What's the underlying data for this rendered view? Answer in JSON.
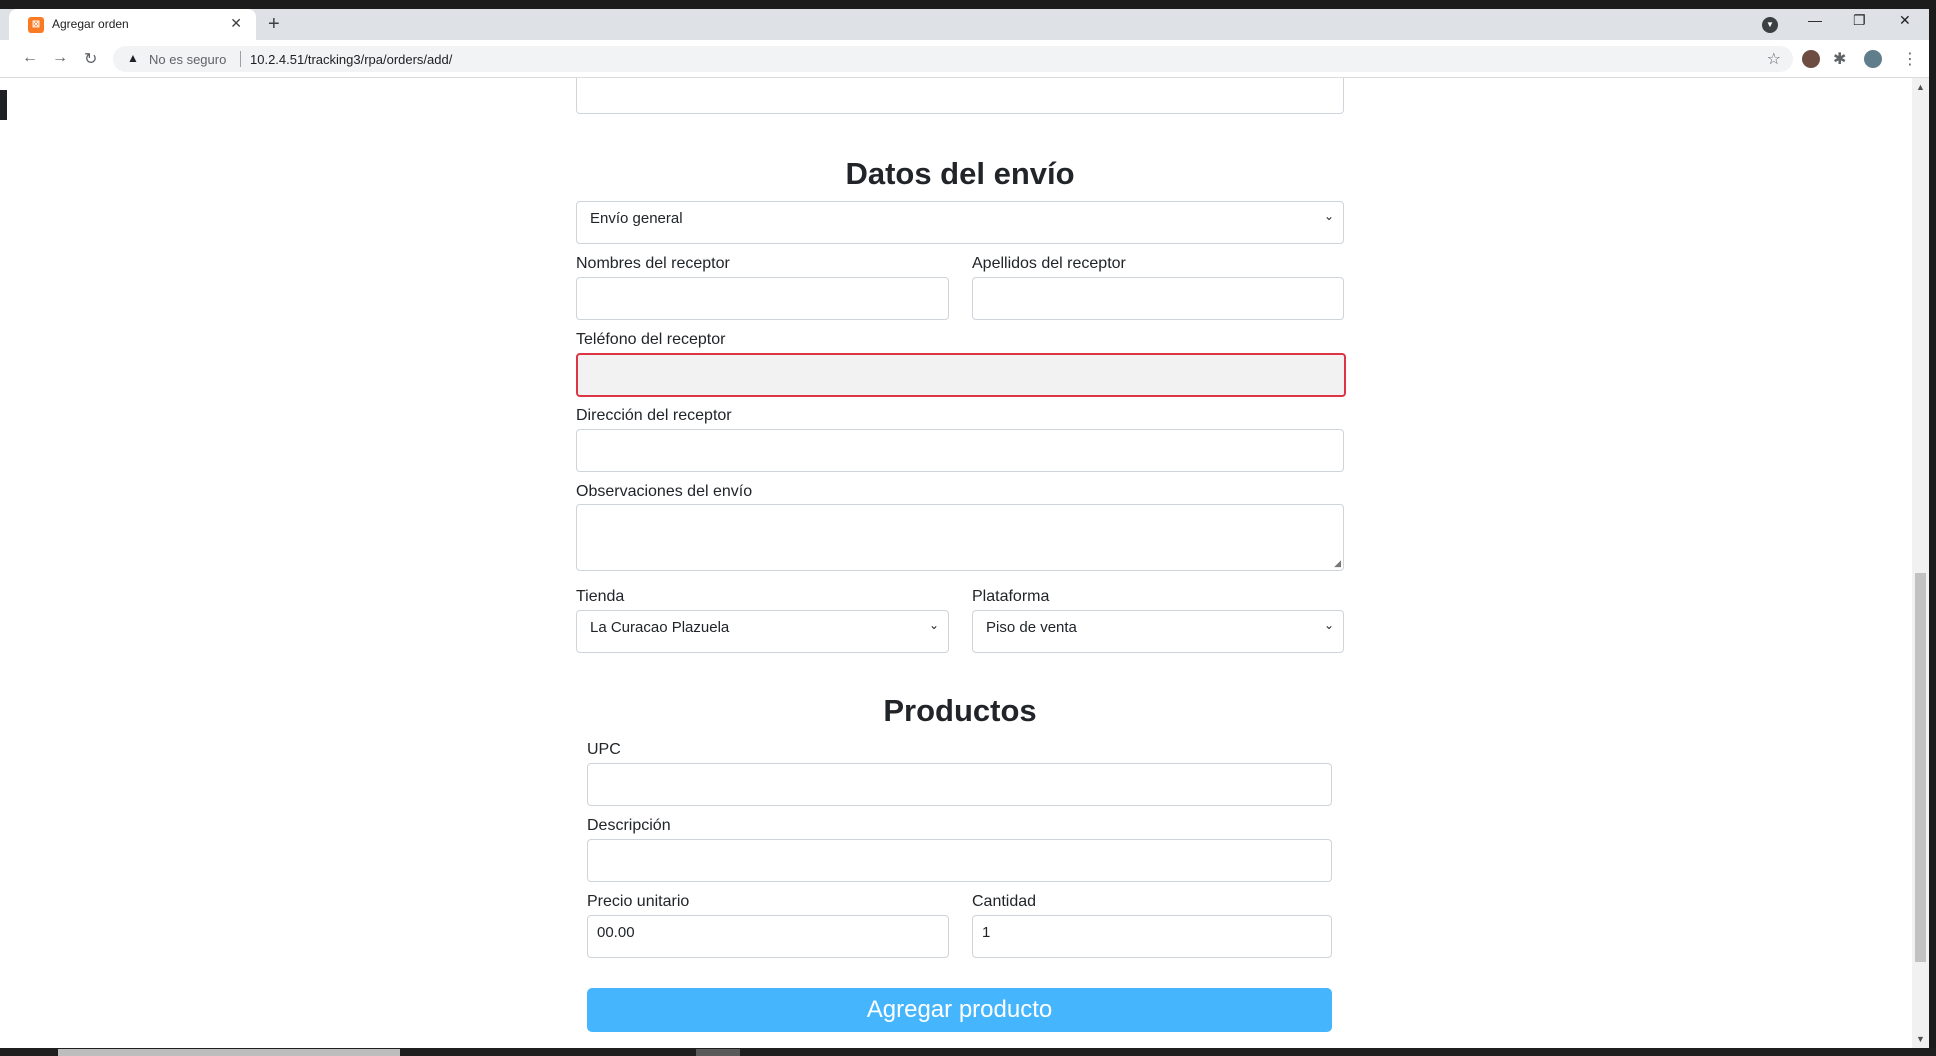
{
  "browser": {
    "tab_title": "Agregar orden",
    "tab_favicon": "XAMPP",
    "new_tab": "+",
    "security_label": "No es seguro",
    "url": "10.2.4.51/tracking3/rpa/orders/add/"
  },
  "shipping": {
    "heading": "Datos del envío",
    "shipping_type": "Envío general",
    "receiver_first_names_label": "Nombres del receptor",
    "receiver_last_names_label": "Apellidos del receptor",
    "receiver_phone_label": "Teléfono del receptor",
    "receiver_address_label": "Dirección del receptor",
    "notes_label": "Observaciones del envío",
    "store_label": "Tienda",
    "store_value": "La Curacao Plazuela",
    "platform_label": "Plataforma",
    "platform_value": "Piso de venta"
  },
  "products": {
    "heading": "Productos",
    "upc_label": "UPC",
    "description_label": "Descripción",
    "unit_price_label": "Precio unitario",
    "unit_price_value": "00.00",
    "quantity_label": "Cantidad",
    "quantity_value": "1",
    "add_button": "Agregar producto"
  },
  "colors": {
    "button": "#45b6fe",
    "invalid_border": "#dc3545"
  }
}
